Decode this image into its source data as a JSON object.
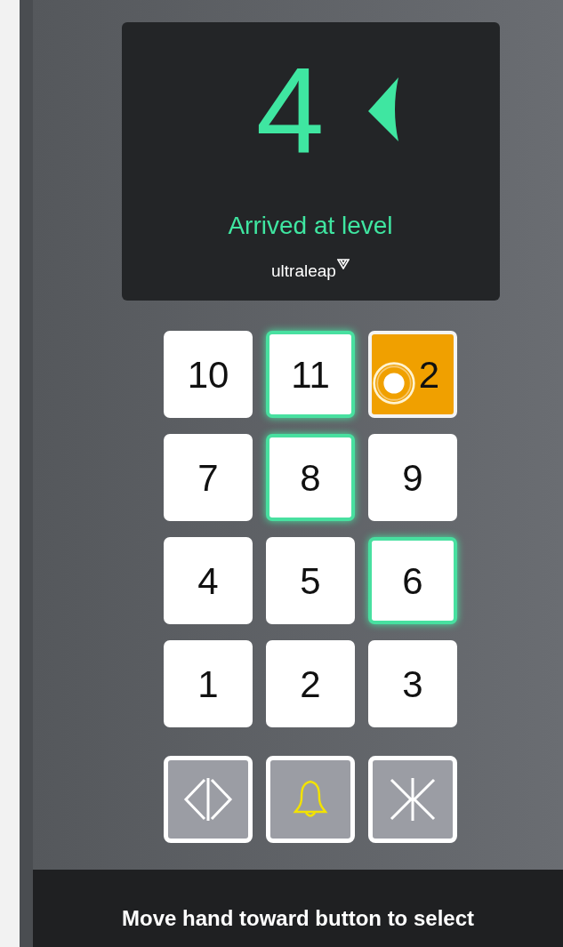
{
  "display": {
    "floor": "4",
    "message": "Arrived at level",
    "brand": "ultraleap"
  },
  "floor_buttons": [
    {
      "label": "10",
      "lit": false,
      "pressed": false,
      "hovered": false
    },
    {
      "label": "11",
      "lit": true,
      "pressed": false,
      "hovered": false
    },
    {
      "label": "2",
      "lit": false,
      "pressed": true,
      "hovered": true
    },
    {
      "label": "7",
      "lit": false,
      "pressed": false,
      "hovered": false
    },
    {
      "label": "8",
      "lit": true,
      "pressed": false,
      "hovered": false
    },
    {
      "label": "9",
      "lit": false,
      "pressed": false,
      "hovered": false
    },
    {
      "label": "4",
      "lit": false,
      "pressed": false,
      "hovered": false
    },
    {
      "label": "5",
      "lit": false,
      "pressed": false,
      "hovered": false
    },
    {
      "label": "6",
      "lit": true,
      "pressed": false,
      "hovered": false
    },
    {
      "label": "1",
      "lit": false,
      "pressed": false,
      "hovered": false
    },
    {
      "label": "2",
      "lit": false,
      "pressed": false,
      "hovered": false
    },
    {
      "label": "3",
      "lit": false,
      "pressed": false,
      "hovered": false
    }
  ],
  "control_buttons": [
    {
      "kind": "open"
    },
    {
      "kind": "alarm"
    },
    {
      "kind": "close"
    }
  ],
  "hint": "Move hand toward button to select"
}
